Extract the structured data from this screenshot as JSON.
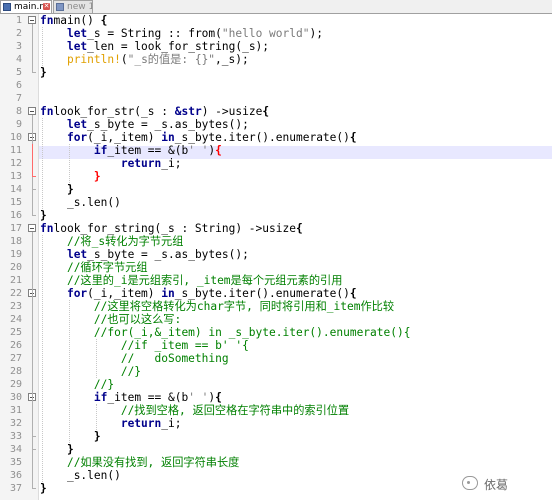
{
  "tabs": [
    {
      "label": "main.rs",
      "active": true
    },
    {
      "label": "new 1",
      "active": false
    }
  ],
  "current_line": 11,
  "lines": [
    [
      [
        "kw",
        "fn"
      ],
      [
        "",
        "main() "
      ],
      [
        "br",
        "{"
      ]
    ],
    [
      [
        "",
        "    "
      ],
      [
        "kw",
        "let"
      ],
      [
        "",
        "",
        " "
      ],
      [
        "",
        "_s = String :: from("
      ],
      [
        "str",
        "\"hello world\""
      ],
      [
        "",
        ");"
      ]
    ],
    [
      [
        "",
        "    "
      ],
      [
        "kw",
        "let"
      ],
      [
        "",
        "",
        " "
      ],
      [
        "",
        "_len = look_for_string(_s);"
      ]
    ],
    [
      [
        "",
        "    "
      ],
      [
        "mac",
        "println!"
      ],
      [
        "",
        "("
      ],
      [
        "str",
        "\"_s的值是: {}\""
      ],
      [
        "",
        ",_s);"
      ]
    ],
    [
      [
        "br",
        "}"
      ]
    ],
    [
      [
        "",
        ""
      ]
    ],
    [
      [
        "",
        ""
      ]
    ],
    [
      [
        "kw",
        "fn"
      ],
      [
        "",
        "",
        " "
      ],
      [
        "",
        "look_for_str(_s : "
      ],
      [
        "kw",
        "&str"
      ],
      [
        "",
        ") ->usize"
      ],
      [
        "br",
        "{"
      ]
    ],
    [
      [
        "",
        "    "
      ],
      [
        "kw",
        "let"
      ],
      [
        "",
        "",
        " "
      ],
      [
        "",
        "_s_byte = _s.as_bytes();"
      ]
    ],
    [
      [
        "",
        "    "
      ],
      [
        "kw",
        "for"
      ],
      [
        "",
        "(_i,_item) "
      ],
      [
        "kw",
        "in"
      ],
      [
        "",
        "",
        " "
      ],
      [
        "",
        "_s_byte.iter().enumerate()"
      ],
      [
        "br",
        "{"
      ]
    ],
    [
      [
        "",
        "        "
      ],
      [
        "kw",
        "if"
      ],
      [
        "",
        "",
        " "
      ],
      [
        "",
        "_item == &(b"
      ],
      [
        "str",
        "' '"
      ],
      [
        "",
        ")"
      ],
      [
        "brhl",
        "{"
      ]
    ],
    [
      [
        "",
        "            "
      ],
      [
        "kw",
        "return"
      ],
      [
        "",
        "",
        " "
      ],
      [
        "",
        "_i;"
      ]
    ],
    [
      [
        "",
        "        "
      ],
      [
        "brhl",
        "}"
      ]
    ],
    [
      [
        "",
        "    "
      ],
      [
        "br",
        "}"
      ]
    ],
    [
      [
        "",
        "    "
      ],
      [
        "",
        "_s.len()"
      ]
    ],
    [
      [
        "br",
        "}"
      ]
    ],
    [
      [
        "kw",
        "fn"
      ],
      [
        "",
        "",
        " "
      ],
      [
        "",
        "look_for_string(_s : String) ->usize"
      ],
      [
        "br",
        "{"
      ]
    ],
    [
      [
        "",
        "    "
      ],
      [
        "cmt",
        "//将_s转化为字节元组"
      ]
    ],
    [
      [
        "",
        "    "
      ],
      [
        "kw",
        "let"
      ],
      [
        "",
        "",
        " "
      ],
      [
        "",
        "_s_byte = _s.as_bytes();"
      ]
    ],
    [
      [
        "",
        "    "
      ],
      [
        "cmt",
        "//循环字节元组"
      ]
    ],
    [
      [
        "",
        "    "
      ],
      [
        "cmt",
        "//这里的_i是元组索引, _item是每个元组元素的引用"
      ]
    ],
    [
      [
        "",
        "    "
      ],
      [
        "kw",
        "for"
      ],
      [
        "",
        "(_i,_item) "
      ],
      [
        "kw",
        "in"
      ],
      [
        "",
        "",
        " "
      ],
      [
        "",
        "_s_byte.iter().enumerate()"
      ],
      [
        "br",
        "{"
      ]
    ],
    [
      [
        "",
        "        "
      ],
      [
        "cmt",
        "//这里将空格转化为char字节, 同时将引用和_item作比较"
      ]
    ],
    [
      [
        "",
        "        "
      ],
      [
        "cmt",
        "//也可以这么写:"
      ]
    ],
    [
      [
        "",
        "        "
      ],
      [
        "cmt",
        "//for(_i,&_item) in _s_byte.iter().enumerate(){"
      ]
    ],
    [
      [
        "",
        "            "
      ],
      [
        "cmt",
        "//if _item == b' '{"
      ]
    ],
    [
      [
        "",
        "            "
      ],
      [
        "cmt",
        "//   doSomething"
      ]
    ],
    [
      [
        "",
        "            "
      ],
      [
        "cmt",
        "//}"
      ]
    ],
    [
      [
        "",
        "        "
      ],
      [
        "cmt",
        "//}"
      ]
    ],
    [
      [
        "",
        "        "
      ],
      [
        "kw",
        "if"
      ],
      [
        "",
        "",
        " "
      ],
      [
        "",
        "_item == &(b"
      ],
      [
        "str",
        "' '"
      ],
      [
        "",
        ")"
      ],
      [
        "br",
        "{"
      ]
    ],
    [
      [
        "",
        "            "
      ],
      [
        "cmt",
        "//找到空格, 返回空格在字符串中的索引位置"
      ]
    ],
    [
      [
        "",
        "            "
      ],
      [
        "kw",
        "return"
      ],
      [
        "",
        "",
        " "
      ],
      [
        "",
        "_i;"
      ]
    ],
    [
      [
        "",
        "        "
      ],
      [
        "br",
        "}"
      ]
    ],
    [
      [
        "",
        "    "
      ],
      [
        "br",
        "}"
      ]
    ],
    [
      [
        "",
        "    "
      ],
      [
        "cmt",
        "//如果没有找到, 返回字符串长度"
      ]
    ],
    [
      [
        "",
        "    "
      ],
      [
        "",
        "_s.len()"
      ]
    ],
    [
      [
        "br",
        "}"
      ]
    ]
  ],
  "watermark": {
    "text": "依葛"
  }
}
